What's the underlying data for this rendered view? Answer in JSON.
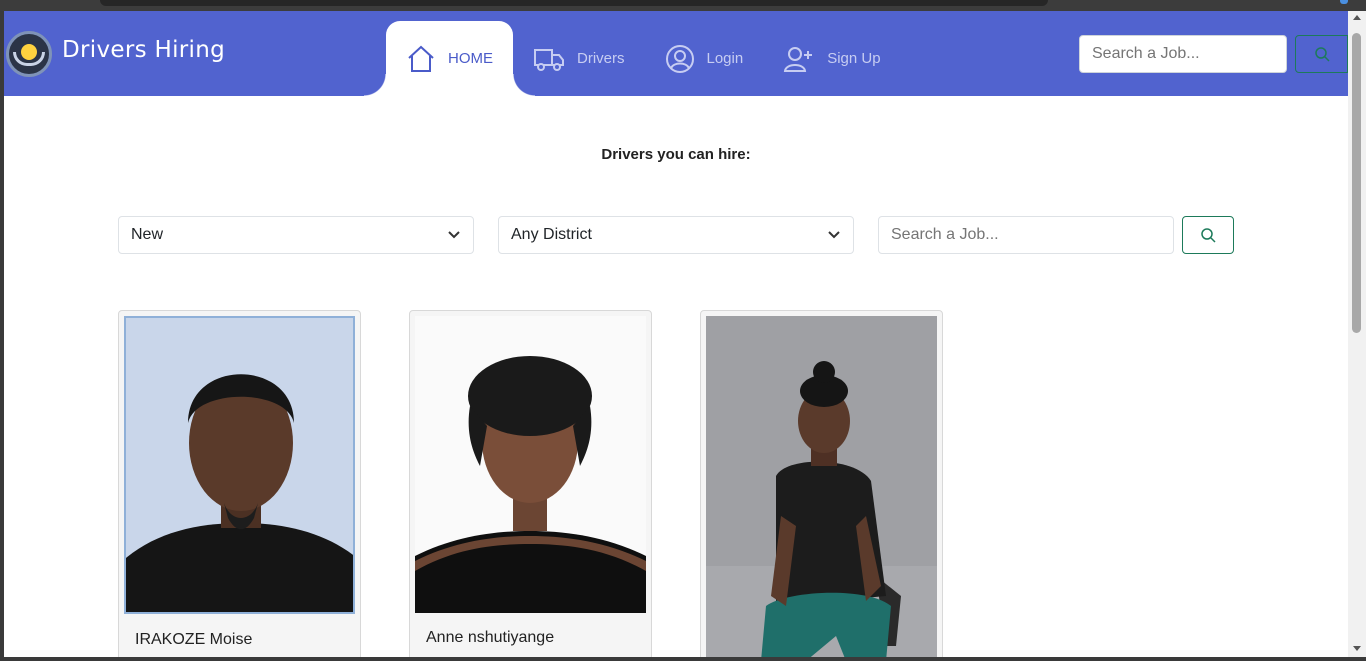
{
  "brand": {
    "name": "Drivers Hiring",
    "logo_icon": "steering-wheel-icon"
  },
  "nav": {
    "items": [
      {
        "label": "HOME",
        "icon": "home-icon",
        "active": true
      },
      {
        "label": "Drivers",
        "icon": "truck-icon",
        "active": false
      },
      {
        "label": "Login",
        "icon": "user-circle-icon",
        "active": false
      },
      {
        "label": "Sign Up",
        "icon": "user-plus-icon",
        "active": false
      }
    ],
    "search_placeholder": "Search a Job..."
  },
  "main": {
    "heading": "Drivers you can hire:",
    "filters": {
      "sort_value": "New",
      "district_value": "Any District",
      "search_placeholder": "Search a Job..."
    },
    "drivers": [
      {
        "name": "IRAKOZE Moise"
      },
      {
        "name": "Anne nshutiyange"
      },
      {
        "name": ""
      }
    ]
  },
  "colors": {
    "navbar": "#5163cf",
    "accent": "#1d7a5a",
    "active_text": "#4a5bc9"
  }
}
